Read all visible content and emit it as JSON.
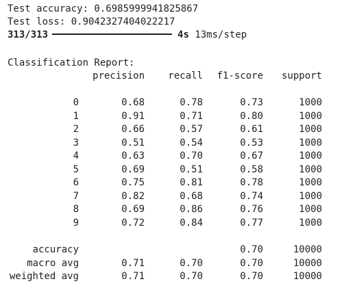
{
  "output": {
    "test_accuracy": "Test accuracy: 0.6985999941825867",
    "test_loss": "Test loss: 0.9042327404022217",
    "progress": {
      "count": "313/313",
      "fraction": 1.0,
      "time": "4s",
      "rate": "13ms/step"
    },
    "report_title": "Classification Report:",
    "headers": {
      "precision": "precision",
      "recall": "recall",
      "f1": "f1-score",
      "support": "support"
    },
    "rows": [
      {
        "label": "0",
        "precision": "0.68",
        "recall": "0.78",
        "f1": "0.73",
        "support": "1000"
      },
      {
        "label": "1",
        "precision": "0.91",
        "recall": "0.71",
        "f1": "0.80",
        "support": "1000"
      },
      {
        "label": "2",
        "precision": "0.66",
        "recall": "0.57",
        "f1": "0.61",
        "support": "1000"
      },
      {
        "label": "3",
        "precision": "0.51",
        "recall": "0.54",
        "f1": "0.53",
        "support": "1000"
      },
      {
        "label": "4",
        "precision": "0.63",
        "recall": "0.70",
        "f1": "0.67",
        "support": "1000"
      },
      {
        "label": "5",
        "precision": "0.69",
        "recall": "0.51",
        "f1": "0.58",
        "support": "1000"
      },
      {
        "label": "6",
        "precision": "0.75",
        "recall": "0.81",
        "f1": "0.78",
        "support": "1000"
      },
      {
        "label": "7",
        "precision": "0.82",
        "recall": "0.68",
        "f1": "0.74",
        "support": "1000"
      },
      {
        "label": "8",
        "precision": "0.69",
        "recall": "0.86",
        "f1": "0.76",
        "support": "1000"
      },
      {
        "label": "9",
        "precision": "0.72",
        "recall": "0.84",
        "f1": "0.77",
        "support": "1000"
      }
    ],
    "summary": [
      {
        "label": "accuracy",
        "precision": "",
        "recall": "",
        "f1": "0.70",
        "support": "10000"
      },
      {
        "label": "macro avg",
        "precision": "0.71",
        "recall": "0.70",
        "f1": "0.70",
        "support": "10000"
      },
      {
        "label": "weighted avg",
        "precision": "0.71",
        "recall": "0.70",
        "f1": "0.70",
        "support": "10000"
      }
    ]
  }
}
